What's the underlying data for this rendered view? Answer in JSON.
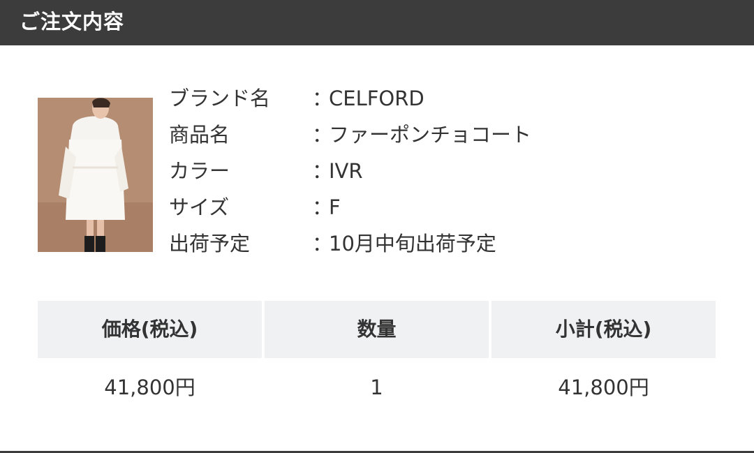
{
  "header": {
    "title": "ご注文内容"
  },
  "product": {
    "image_description": "",
    "details": [
      {
        "label": "ブランド名",
        "colon": "：",
        "value": "CELFORD"
      },
      {
        "label": "商品名",
        "colon": "：",
        "value": "ファーポンチョコート"
      },
      {
        "label": "カラー",
        "colon": "：",
        "value": "IVR"
      },
      {
        "label": "サイズ",
        "colon": "：",
        "value": "F"
      },
      {
        "label": "出荷予定",
        "colon": "：",
        "value": "10月中旬出荷予定"
      }
    ]
  },
  "table": {
    "headers": [
      "価格(税込)",
      "数量",
      "小計(税込)"
    ],
    "row": [
      "41,800円",
      "1",
      "41,800円"
    ]
  },
  "colors": {
    "header_bg": "#3c3c3c",
    "table_header_bg": "#f0f1f3",
    "text": "#333333"
  }
}
